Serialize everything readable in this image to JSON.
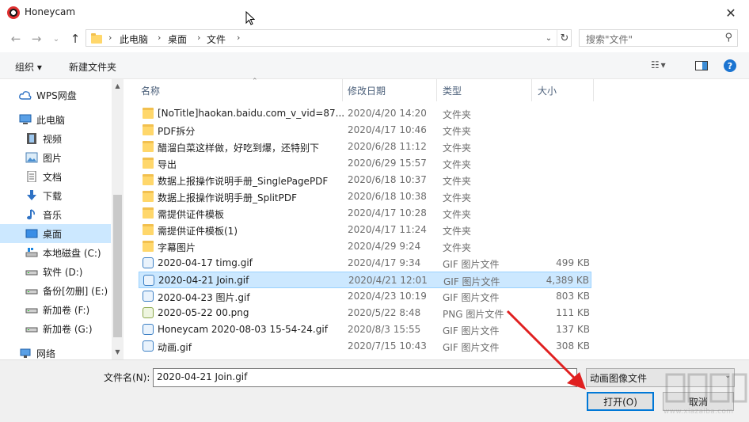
{
  "window": {
    "title": "Honeycam",
    "close_label": "✕"
  },
  "nav": {
    "back": "←",
    "forward": "→",
    "dropdown": "⌄",
    "up": "↑",
    "breadcrumbs": [
      "此电脑",
      "桌面",
      "文件"
    ],
    "search_placeholder": "搜索\"文件\""
  },
  "toolbar": {
    "organize": "组织",
    "new_folder": "新建文件夹"
  },
  "sidebar": {
    "items": [
      {
        "label": "WPS网盘",
        "icon": "cloud-icon"
      },
      {
        "label": "此电脑",
        "icon": "computer-icon"
      },
      {
        "label": "视频",
        "icon": "video-icon"
      },
      {
        "label": "图片",
        "icon": "picture-icon"
      },
      {
        "label": "文档",
        "icon": "document-icon"
      },
      {
        "label": "下载",
        "icon": "download-icon"
      },
      {
        "label": "音乐",
        "icon": "music-icon"
      },
      {
        "label": "桌面",
        "icon": "desktop-icon",
        "selected": true
      },
      {
        "label": "本地磁盘 (C:)",
        "icon": "drive-icon"
      },
      {
        "label": "软件 (D:)",
        "icon": "drive-icon"
      },
      {
        "label": "备份[勿删] (E:)",
        "icon": "drive-icon"
      },
      {
        "label": "新加卷 (F:)",
        "icon": "drive-icon"
      },
      {
        "label": "新加卷 (G:)",
        "icon": "drive-icon"
      },
      {
        "label": "网络",
        "icon": "network-icon"
      }
    ]
  },
  "columns": {
    "name": "名称",
    "date": "修改日期",
    "type": "类型",
    "size": "大小"
  },
  "files": [
    {
      "name": "[NoTitle]haokan.baidu.com_v_vid=87...",
      "date": "2020/4/20 14:20",
      "type": "文件夹",
      "size": "",
      "kind": "folder"
    },
    {
      "name": "PDF拆分",
      "date": "2020/4/17 10:46",
      "type": "文件夹",
      "size": "",
      "kind": "folder"
    },
    {
      "name": "醋溜白菜这样做，好吃到爆，还特别下",
      "date": "2020/6/28 11:12",
      "type": "文件夹",
      "size": "",
      "kind": "folder"
    },
    {
      "name": "导出",
      "date": "2020/6/29 15:57",
      "type": "文件夹",
      "size": "",
      "kind": "folder"
    },
    {
      "name": "数据上报操作说明手册_SinglePagePDF",
      "date": "2020/6/18 10:37",
      "type": "文件夹",
      "size": "",
      "kind": "folder"
    },
    {
      "name": "数据上报操作说明手册_SplitPDF",
      "date": "2020/6/18 10:38",
      "type": "文件夹",
      "size": "",
      "kind": "folder"
    },
    {
      "name": "需提供证件模板",
      "date": "2020/4/17 10:28",
      "type": "文件夹",
      "size": "",
      "kind": "folder"
    },
    {
      "name": "需提供证件模板(1)",
      "date": "2020/4/17 11:24",
      "type": "文件夹",
      "size": "",
      "kind": "folder"
    },
    {
      "name": "字幕图片",
      "date": "2020/4/29 9:24",
      "type": "文件夹",
      "size": "",
      "kind": "folder"
    },
    {
      "name": "2020-04-17 timg.gif",
      "date": "2020/4/17 9:34",
      "type": "GIF 图片文件",
      "size": "499 KB",
      "kind": "gif"
    },
    {
      "name": "2020-04-21 Join.gif",
      "date": "2020/4/21 12:01",
      "type": "GIF 图片文件",
      "size": "4,389 KB",
      "kind": "gif",
      "selected": true
    },
    {
      "name": "2020-04-23 图片.gif",
      "date": "2020/4/23 10:19",
      "type": "GIF 图片文件",
      "size": "803 KB",
      "kind": "gif"
    },
    {
      "name": "2020-05-22 00.png",
      "date": "2020/5/22 8:48",
      "type": "PNG 图片文件",
      "size": "111 KB",
      "kind": "png"
    },
    {
      "name": "Honeycam 2020-08-03 15-54-24.gif",
      "date": "2020/8/3 15:55",
      "type": "GIF 图片文件",
      "size": "137 KB",
      "kind": "gif"
    },
    {
      "name": "动画.gif",
      "date": "2020/7/15 10:43",
      "type": "GIF 图片文件",
      "size": "308 KB",
      "kind": "gif"
    }
  ],
  "footer": {
    "filename_label": "文件名(N):",
    "filename_value": "2020-04-21 Join.gif",
    "filetype_value": "动画图像文件",
    "open_label": "打开(O)",
    "cancel_label": "取消"
  },
  "colors": {
    "selection": "#cce8ff",
    "accent": "#0078d7",
    "arrow": "#e02020"
  },
  "watermark": {
    "text": "www.xiazaiba.com"
  }
}
